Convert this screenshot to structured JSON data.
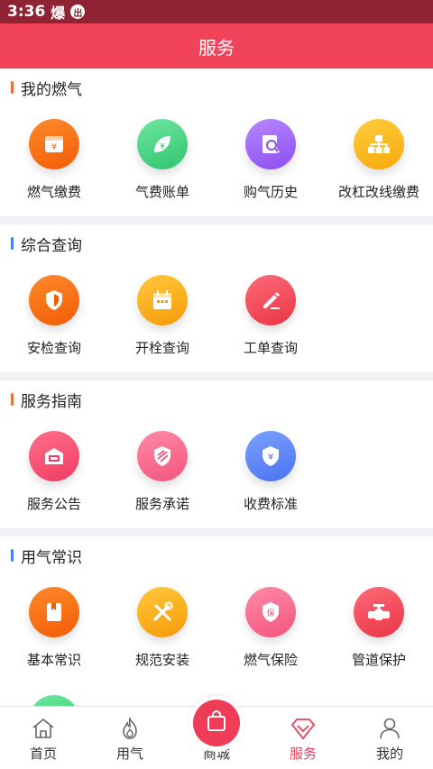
{
  "status_bar": {
    "time": "3:36",
    "app_glyph": "爆",
    "badge": "出"
  },
  "header": {
    "title": "服务"
  },
  "colors": {
    "accent": "#f1445b",
    "status": "#8f2333",
    "tab_active": "#e8405a"
  },
  "sections": [
    {
      "title": "我的燃气",
      "bar_color": "#f26b3a",
      "items": [
        {
          "label": "燃气缴费",
          "icon": "gas-bill-icon",
          "glyph": "¥",
          "from": "#ff8a2b",
          "to": "#f25c05"
        },
        {
          "label": "气费账单",
          "icon": "leaf-bill-icon",
          "glyph": "¥",
          "from": "#6fe6a0",
          "to": "#2fc56e"
        },
        {
          "label": "购气历史",
          "icon": "history-search-icon",
          "glyph": "",
          "from": "#b787ff",
          "to": "#8c4df0"
        },
        {
          "label": "改杠改线缴费",
          "icon": "pipeline-network-icon",
          "glyph": "",
          "from": "#ffce3d",
          "to": "#f7a70a"
        }
      ]
    },
    {
      "title": "综合查询",
      "bar_color": "#4c7cf0",
      "items": [
        {
          "label": "安检查询",
          "icon": "shield-check-icon",
          "glyph": "",
          "from": "#ff8a2b",
          "to": "#f25c05"
        },
        {
          "label": "开栓查询",
          "icon": "calendar-icon",
          "glyph": "",
          "from": "#ffc93a",
          "to": "#f59a0a"
        },
        {
          "label": "工单查询",
          "icon": "edit-icon",
          "glyph": "",
          "from": "#ff6b76",
          "to": "#e93447"
        }
      ]
    },
    {
      "title": "服务指南",
      "bar_color": "#f26b3a",
      "items": [
        {
          "label": "服务公告",
          "icon": "announcement-icon",
          "glyph": "",
          "from": "#ff6f8a",
          "to": "#ef3c63"
        },
        {
          "label": "服务承诺",
          "icon": "promise-shield-icon",
          "glyph": "",
          "from": "#ff8aa8",
          "to": "#f2557c"
        },
        {
          "label": "收费标准",
          "icon": "fee-shield-icon",
          "glyph": "¥",
          "from": "#7aa2ff",
          "to": "#4b72f0"
        }
      ]
    },
    {
      "title": "用气常识",
      "bar_color": "#4c7cf0",
      "items": [
        {
          "label": "基本常识",
          "icon": "book-icon",
          "glyph": "",
          "from": "#ff8a2b",
          "to": "#f25c05"
        },
        {
          "label": "规范安装",
          "icon": "tools-icon",
          "glyph": "",
          "from": "#ffc93a",
          "to": "#f59a0a"
        },
        {
          "label": "燃气保险",
          "icon": "insurance-icon",
          "glyph": "保",
          "from": "#ff8aa8",
          "to": "#f2557c"
        },
        {
          "label": "管道保护",
          "icon": "pipe-valve-icon",
          "glyph": "",
          "from": "#ff6b76",
          "to": "#e93447"
        },
        {
          "label": "",
          "icon": "safety-check-icon",
          "glyph": "",
          "from": "#6fe6a0",
          "to": "#2fc56e"
        }
      ]
    }
  ],
  "tabs": [
    {
      "label": "首页",
      "icon": "home-icon"
    },
    {
      "label": "用气",
      "icon": "flame-icon"
    },
    {
      "label": "商城",
      "icon": "shopping-bag-icon"
    },
    {
      "label": "服务",
      "icon": "diamond-icon"
    },
    {
      "label": "我的",
      "icon": "user-icon"
    }
  ]
}
